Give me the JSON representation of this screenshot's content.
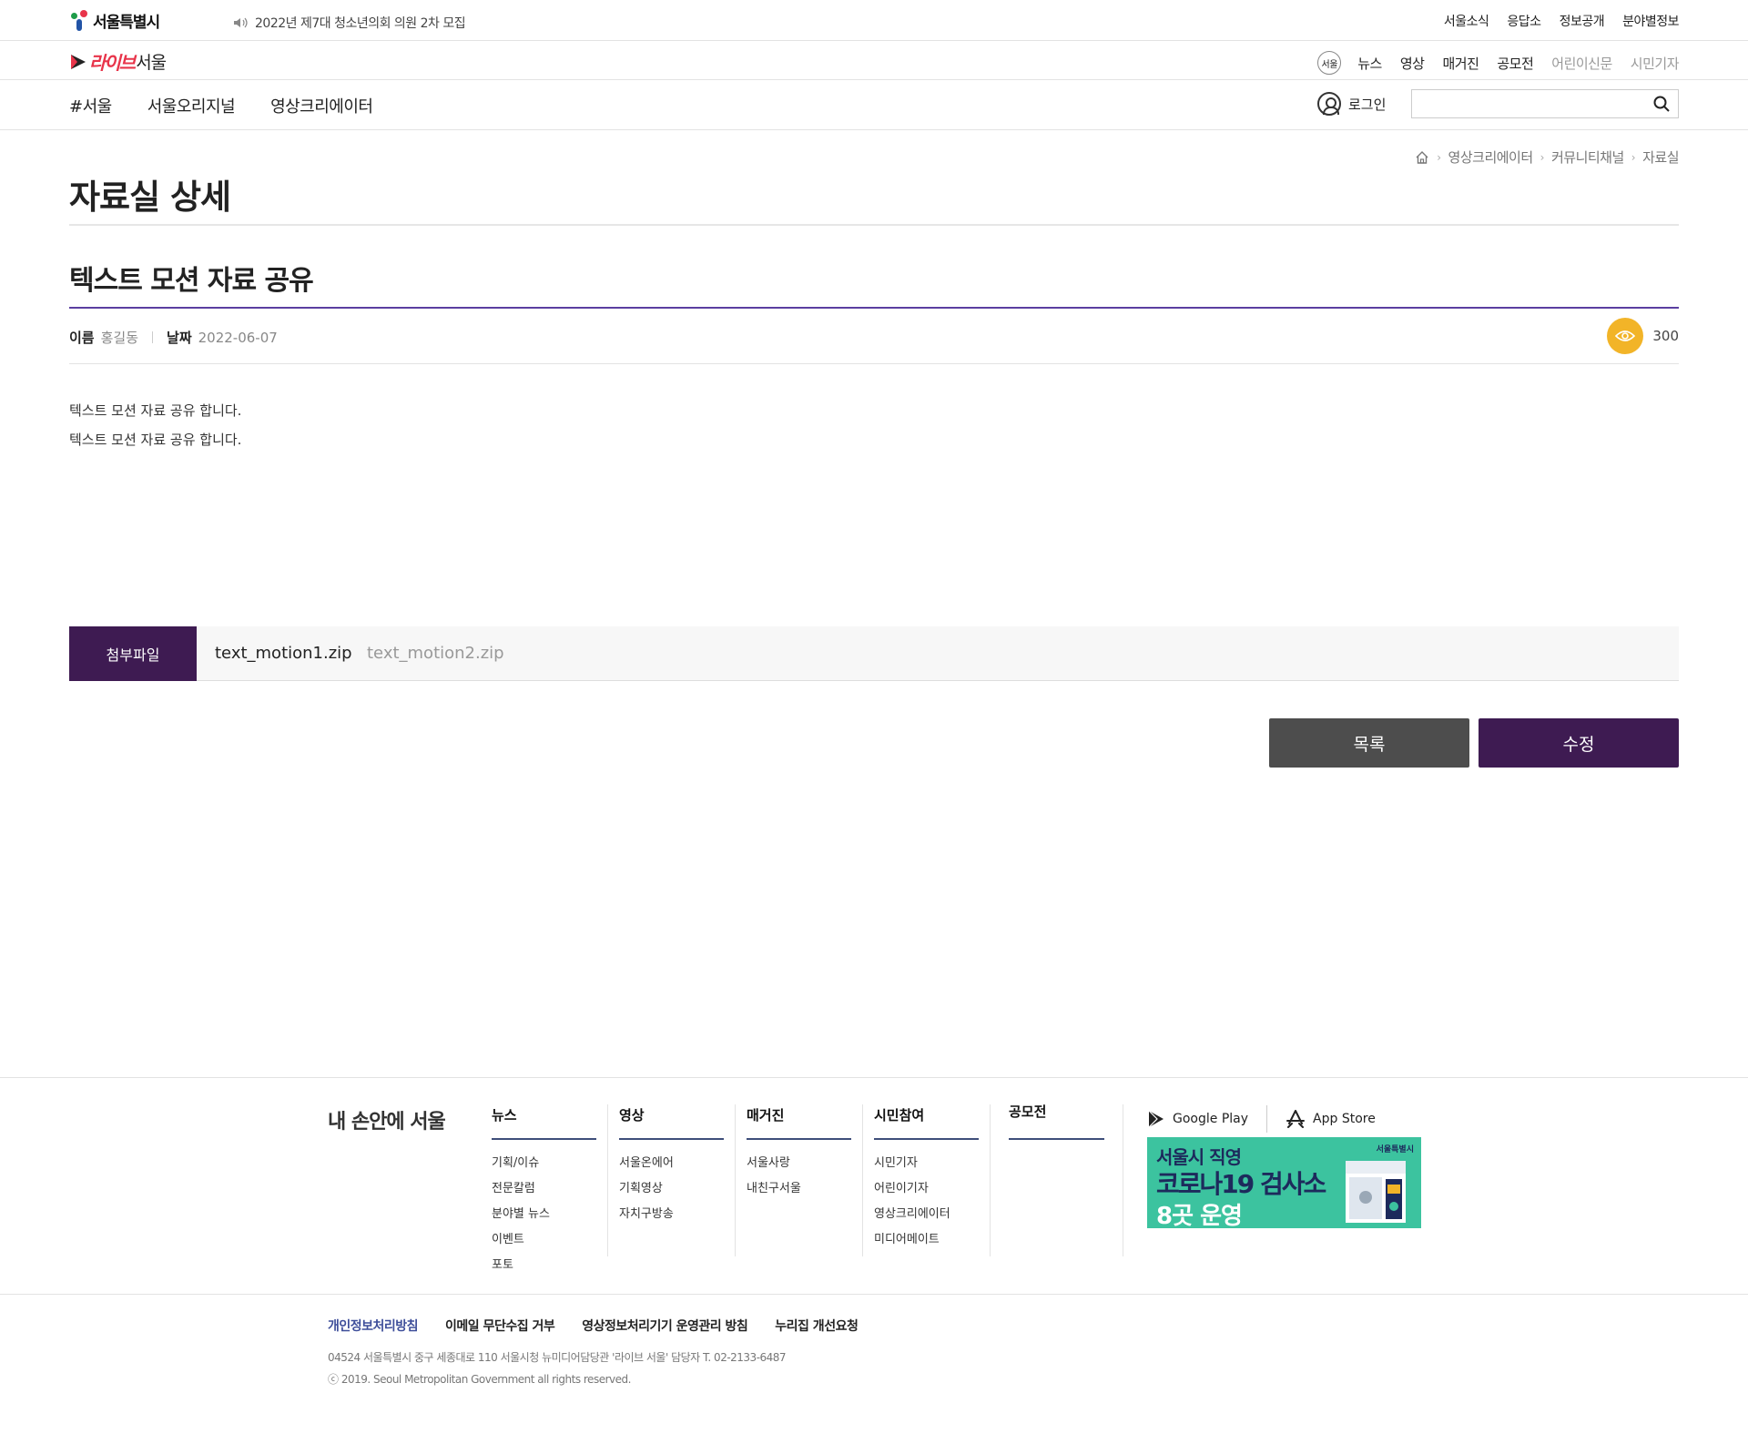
{
  "header": {
    "logo_text": "서울특별시",
    "notice": "2022년 제7대 청소년의회 의원 2차 모집",
    "utility_links": [
      "서울소식",
      "응답소",
      "정보공개",
      "분야별정보"
    ]
  },
  "live_seoul": {
    "logo_script": "라이브",
    "logo_text": "서울",
    "seoul_badge": "서울",
    "menu": [
      "뉴스",
      "영상",
      "매거진",
      "공모전"
    ],
    "menu_dim": [
      "어린이신문",
      "시민기자"
    ]
  },
  "gnb": {
    "items": [
      "#서울",
      "서울오리지널",
      "영상크리에이터"
    ],
    "login_label": "로그인",
    "search_placeholder": ""
  },
  "breadcrumb": [
    "영상크리에이터",
    "커뮤니티채널",
    "자료실"
  ],
  "page_title": "자료실 상세",
  "post": {
    "title": "텍스트 모션 자료 공유",
    "name_label": "이름",
    "name_value": "홍길동",
    "date_label": "날짜",
    "date_value": "2022-06-07",
    "views": "300",
    "content": [
      "텍스트 모션 자료 공유 합니다.",
      "텍스트 모션 자료 공유 합니다."
    ]
  },
  "attachment": {
    "label": "첨부파일",
    "files": [
      "text_motion1.zip",
      "text_motion2.zip"
    ]
  },
  "buttons": {
    "list": "목록",
    "edit": "수정"
  },
  "footer": {
    "brand": "내 손안에 서울",
    "columns": [
      {
        "title": "뉴스",
        "items": [
          "기획/이슈",
          "전문칼럼",
          "분야별 뉴스",
          "이벤트",
          "포토"
        ]
      },
      {
        "title": "영상",
        "items": [
          "서울온에어",
          "기획영상",
          "자치구방송"
        ]
      },
      {
        "title": "매거진",
        "items": [
          "서울사랑",
          "내친구서울"
        ]
      },
      {
        "title": "시민참여",
        "items": [
          "시민기자",
          "어린이기자",
          "영상크리에이터",
          "미디어메이트"
        ]
      },
      {
        "title": "공모전",
        "items": []
      }
    ],
    "apps": [
      "Google Play",
      "App Store"
    ],
    "banner": {
      "line1": "서울시 직영",
      "line2": "코로나19 검사소",
      "line3": "8곳 운영",
      "logo": "서울특별시"
    },
    "links": [
      "개인정보처리방침",
      "이메일 무단수집 거부",
      "영상정보처리기기 운영관리 방침",
      "누리집 개선요청"
    ],
    "address": "04524 서울특별시 중구 세종대로 110 서울시청 뉴미디어담당관 '라이브 서울'      담당자 T. 02-2133-6487",
    "copyright": "ⓒ 2019. Seoul Metropolitan Government all rights reserved."
  },
  "colors": {
    "brand_purple": "#3e1b52",
    "accent_line": "#5a3fa0",
    "views_badge": "#f2b428",
    "banner_bg": "#3cc39f"
  }
}
